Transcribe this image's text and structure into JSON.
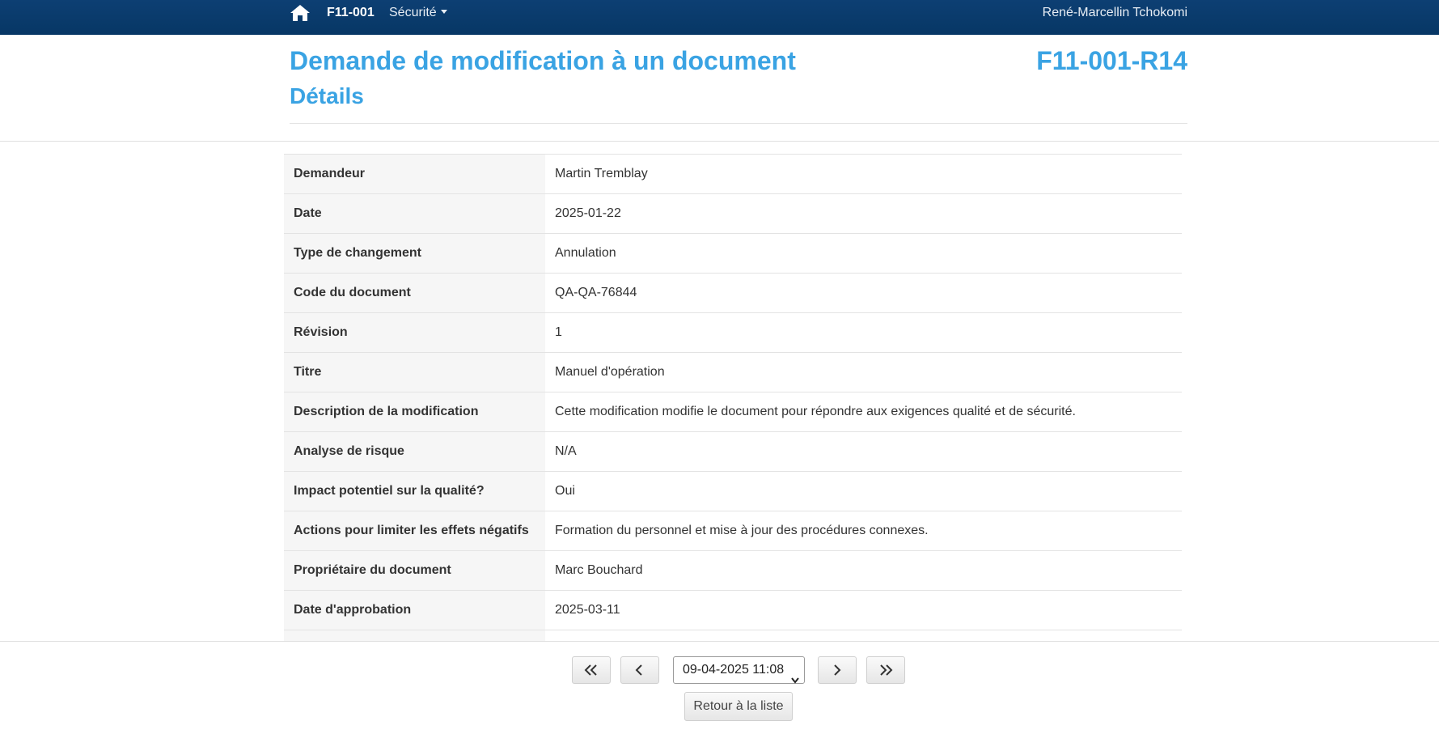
{
  "navbar": {
    "brand": "F11-001",
    "menu_label": "Sécurité",
    "user": "René-Marcellin Tchokomi"
  },
  "header": {
    "title": "Demande de modification à un document",
    "subtitle": "Détails",
    "code": "F11-001-R14"
  },
  "details": [
    {
      "label": "Demandeur",
      "value": "Martin Tremblay"
    },
    {
      "label": "Date",
      "value": "2025-01-22"
    },
    {
      "label": "Type de changement",
      "value": "Annulation"
    },
    {
      "label": "Code du document",
      "value": "QA-QA-76844"
    },
    {
      "label": "Révision",
      "value": "1"
    },
    {
      "label": "Titre",
      "value": "Manuel d'opération"
    },
    {
      "label": "Description de la modification",
      "value": "Cette modification modifie le document pour répondre aux exigences qualité et de sécurité."
    },
    {
      "label": "Analyse de risque",
      "value": "N/A"
    },
    {
      "label": "Impact potentiel sur la qualité?",
      "value": "Oui"
    },
    {
      "label": "Actions pour limiter les effets négatifs",
      "value": "Formation du personnel et mise à jour des procédures connexes."
    },
    {
      "label": "Propriétaire du document",
      "value": "Marc Bouchard"
    },
    {
      "label": "Date d'approbation",
      "value": "2025-03-11"
    },
    {
      "label": "",
      "value": ""
    }
  ],
  "pager": {
    "selected_version": "09-04-2025 11:08",
    "back_label": "Retour à la liste"
  },
  "icons": {
    "home": "home-icon",
    "first": "double-chevron-left-icon",
    "prev": "chevron-left-icon",
    "next": "chevron-right-icon",
    "last": "double-chevron-right-icon"
  },
  "colors": {
    "navbar": "#0d3f73",
    "accent": "#3aa3e3"
  }
}
